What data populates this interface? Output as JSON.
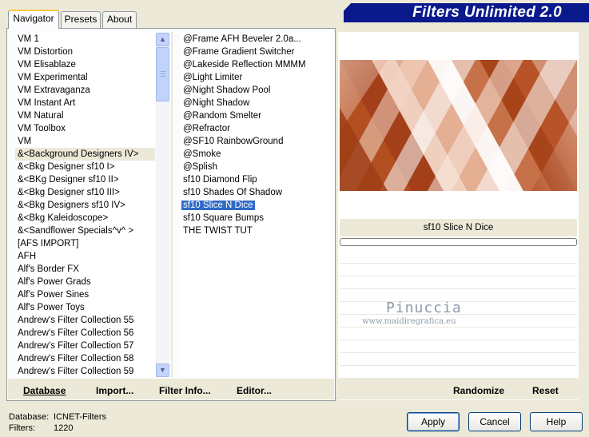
{
  "tabs": [
    {
      "label": "Navigator",
      "active": true
    },
    {
      "label": "Presets",
      "active": false
    },
    {
      "label": "About",
      "active": false
    }
  ],
  "banner_title": "Filters Unlimited 2.0",
  "categories": [
    "VM 1",
    "VM Distortion",
    "VM Elisablaze",
    "VM Experimental",
    "VM Extravaganza",
    "VM Instant Art",
    "VM Natural",
    "VM Toolbox",
    "VM",
    "&<Background Designers IV>",
    "&<Bkg Designer sf10 I>",
    "&<BKg Designer sf10 II>",
    "&<Bkg Designer sf10 III>",
    "&<Bkg Designers sf10 IV>",
    "&<Bkg Kaleidoscope>",
    "&<Sandflower Specials^v^ >",
    "[AFS IMPORT]",
    "AFH",
    "Alf's Border FX",
    "Alf's Power Grads",
    "Alf's Power Sines",
    "Alf's Power Toys",
    "Andrew's Filter Collection 55",
    "Andrew's Filter Collection 56",
    "Andrew's Filter Collection 57",
    "Andrew's Filter Collection 58",
    "Andrew's Filter Collection 59"
  ],
  "selected_category": "&<Background Designers IV>",
  "filters": [
    "@Frame AFH Beveler 2.0a...",
    "@Frame Gradient Switcher",
    "@Lakeside Reflection MMMM",
    "@Light Limiter",
    "@Night Shadow Pool",
    "@Night Shadow",
    "@Random Smelter",
    "@Refractor",
    "@SF10 RainbowGround",
    "@Smoke",
    "@Splish",
    "sf10 Diamond Flip",
    "sf10 Shades Of Shadow",
    "sf10 Slice N Dice",
    "sf10 Square Bumps",
    "THE TWIST TUT"
  ],
  "selected_filter": "sf10 Slice N Dice",
  "preview_label": "sf10 Slice N Dice",
  "watermark": {
    "name": "Pinuccia",
    "url": "www.maidiregrafica.eu"
  },
  "left_buttons": {
    "database": "Database",
    "import": "Import...",
    "filter_info": "Filter Info...",
    "editor": "Editor..."
  },
  "right_buttons": {
    "randomize": "Randomize",
    "reset": "Reset"
  },
  "status": {
    "database_label": "Database:",
    "database_value": "ICNET-Filters",
    "filters_label": "Filters:",
    "filters_value": "1220"
  },
  "dialog_buttons": {
    "apply": "Apply",
    "cancel": "Cancel",
    "help": "Help"
  },
  "colors": {
    "banner": "#0a1a8c",
    "selection": "#316ac5",
    "preview_rust": "#a8441a"
  }
}
